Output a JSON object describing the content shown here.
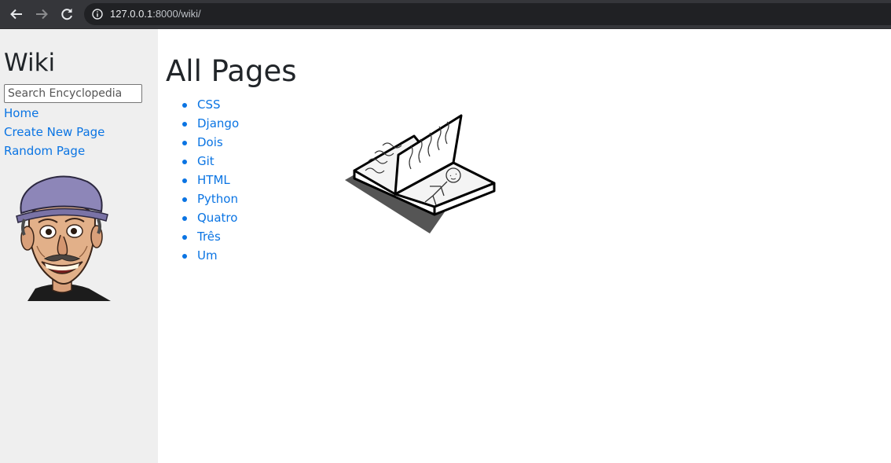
{
  "browser": {
    "url_host": "127.0.0.1",
    "url_rest": ":8000/wiki/",
    "back_icon": "arrow-left-icon",
    "forward_icon": "arrow-right-icon",
    "reload_icon": "reload-icon",
    "info_icon": "info-icon"
  },
  "sidebar": {
    "title": "Wiki",
    "search_placeholder": "Search Encyclopedia",
    "links": [
      "Home",
      "Create New Page",
      "Random Page"
    ]
  },
  "main": {
    "heading": "All Pages",
    "entries": [
      "CSS",
      "Django",
      "Dois",
      "Git",
      "HTML",
      "Python",
      "Quatro",
      "Três",
      "Um"
    ]
  },
  "colors": {
    "link": "#0a74e3",
    "sidebar_bg": "#efefef",
    "chrome_bg": "#35363a"
  }
}
